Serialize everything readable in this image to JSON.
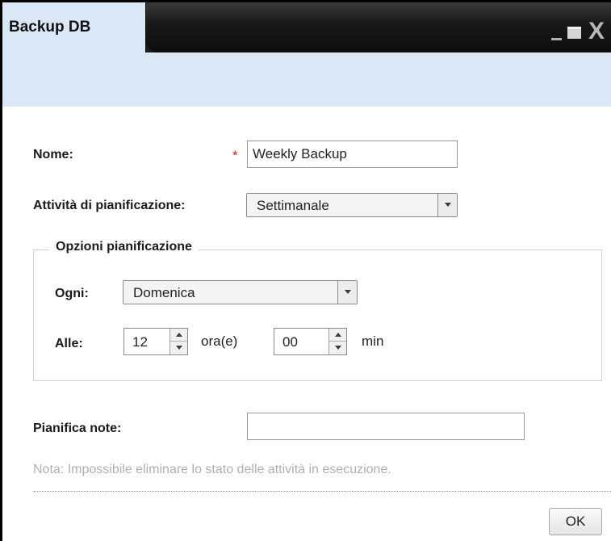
{
  "window": {
    "title": "Backup DB",
    "controls": [
      "minimize-icon",
      "maximize-icon",
      "close-icon"
    ],
    "close_glyph": "X"
  },
  "form": {
    "name_label": "Nome:",
    "name_required_mark": "*",
    "name_value": "Weekly Backup",
    "schedule_label": "Attività di pianificazione:",
    "schedule_value": "Settimanale",
    "options_legend": "Opzioni pianificazione",
    "every_label": "Ogni:",
    "every_value": "Domenica",
    "at_label": "Alle:",
    "hour_value": "12",
    "hour_unit": "ora(e)",
    "minute_value": "00",
    "minute_unit": "min",
    "notes_label": "Pianifica note:",
    "notes_value": "",
    "note_text": "Nota: Impossibile eliminare lo stato delle attività in esecuzione."
  },
  "footer": {
    "ok_label": "OK"
  },
  "colors": {
    "titlebar": "#1c1c1c",
    "header_band": "#d9e7f7",
    "required": "#cc2222",
    "note": "#b0b0b0"
  }
}
